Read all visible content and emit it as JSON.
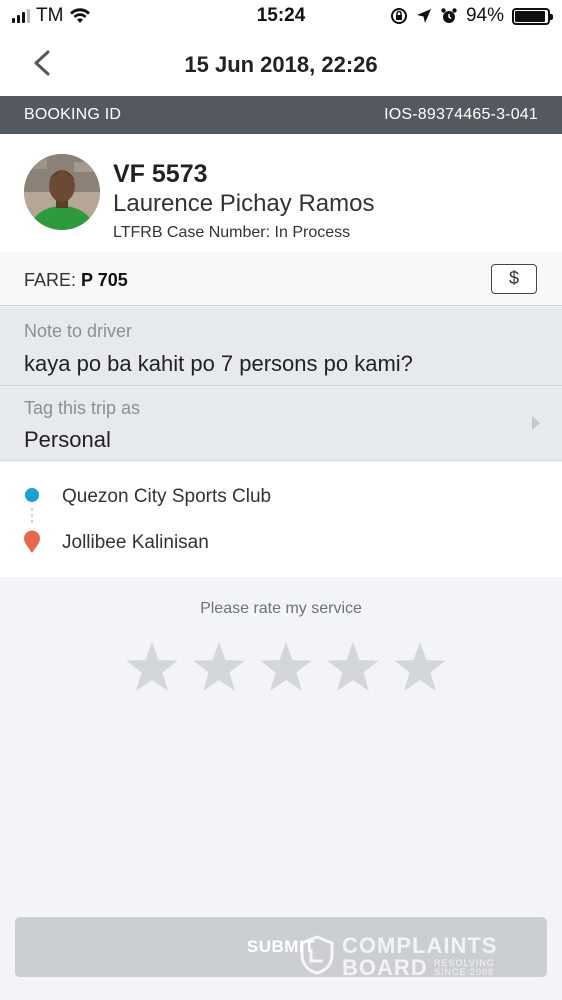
{
  "status_bar": {
    "carrier": "TM",
    "time": "15:24",
    "battery": "94%",
    "battery_level": 0.94,
    "icons": [
      "signal-icon",
      "wifi-icon",
      "orientation-lock-icon",
      "location-icon",
      "alarm-icon",
      "battery-icon"
    ]
  },
  "nav": {
    "title": "15 Jun 2018, 22:26",
    "back_icon": "chevron-left-icon"
  },
  "booking": {
    "label": "BOOKING ID",
    "id": "IOS-89374465-3-041"
  },
  "driver": {
    "plate": "VF 5573",
    "name": "Laurence Pichay Ramos",
    "case_number": "LTFRB Case Number: In Process"
  },
  "fare": {
    "label": "FARE:",
    "amount": "P 705",
    "payment_icon": "$"
  },
  "note": {
    "label": "Note to driver",
    "text": "kaya po ba kahit po 7 persons po kami?"
  },
  "tag": {
    "label": "Tag this trip as",
    "value": "Personal"
  },
  "route": {
    "pickup": "Quezon City Sports Club",
    "dropoff": "Jollibee Kalinisan"
  },
  "rating": {
    "prompt": "Please rate my service",
    "max": 5,
    "value": 0
  },
  "submit": {
    "label": "SUBMIT"
  },
  "watermark": {
    "line1": "COMPLAINTS",
    "line2": "BOARD",
    "tag1": "RESOLVING",
    "tag2": "SINCE 2008"
  },
  "colors": {
    "booking_bar": "#54595f",
    "pickup": "#1aa1cf",
    "dropoff": "#e8674e",
    "star": "#d4d7da",
    "submit_disabled": "#cbcfd3"
  }
}
